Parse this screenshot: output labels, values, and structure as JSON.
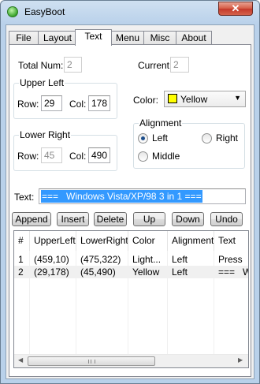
{
  "window": {
    "title": "EasyBoot",
    "close_glyph": "✕"
  },
  "tabs": [
    "File",
    "Layout",
    "Text",
    "Menu",
    "Misc",
    "About"
  ],
  "active_tab": "Text",
  "form": {
    "total_num_label": "Total Num:",
    "total_num_value": "2",
    "current_label": "Current:",
    "current_value": "2",
    "upper_left": {
      "title": "Upper Left",
      "row_label": "Row:",
      "row_value": "29",
      "col_label": "Col:",
      "col_value": "178"
    },
    "lower_right": {
      "title": "Lower Right",
      "row_label": "Row:",
      "row_value": "45",
      "col_label": "Col:",
      "col_value": "490"
    },
    "color_label": "Color:",
    "color_value": "Yellow",
    "color_swatch": "#ffff00",
    "alignment": {
      "title": "Alignment",
      "left": "Left",
      "right": "Right",
      "middle": "Middle",
      "selected": "Left"
    },
    "text_label": "Text:",
    "text_value": "===   Windows Vista/XP/98 3 in 1 ==="
  },
  "buttons": [
    "Append",
    "Insert",
    "Delete",
    "Up",
    "Down",
    "Undo"
  ],
  "list": {
    "columns": [
      "#",
      "UpperLeft",
      "LowerRight",
      "Color",
      "Alignment",
      "Text"
    ],
    "rows": [
      [
        "1",
        "(459,10)",
        "(475,322)",
        "Light...",
        "Left",
        "Press"
      ],
      [
        "2",
        "(29,178)",
        "(45,490)",
        "Yellow",
        "Left",
        "===   W"
      ]
    ]
  },
  "colors": {
    "selection": "#3399ff",
    "title_gradient": "#b9d1ea",
    "close": "#c4382a"
  }
}
